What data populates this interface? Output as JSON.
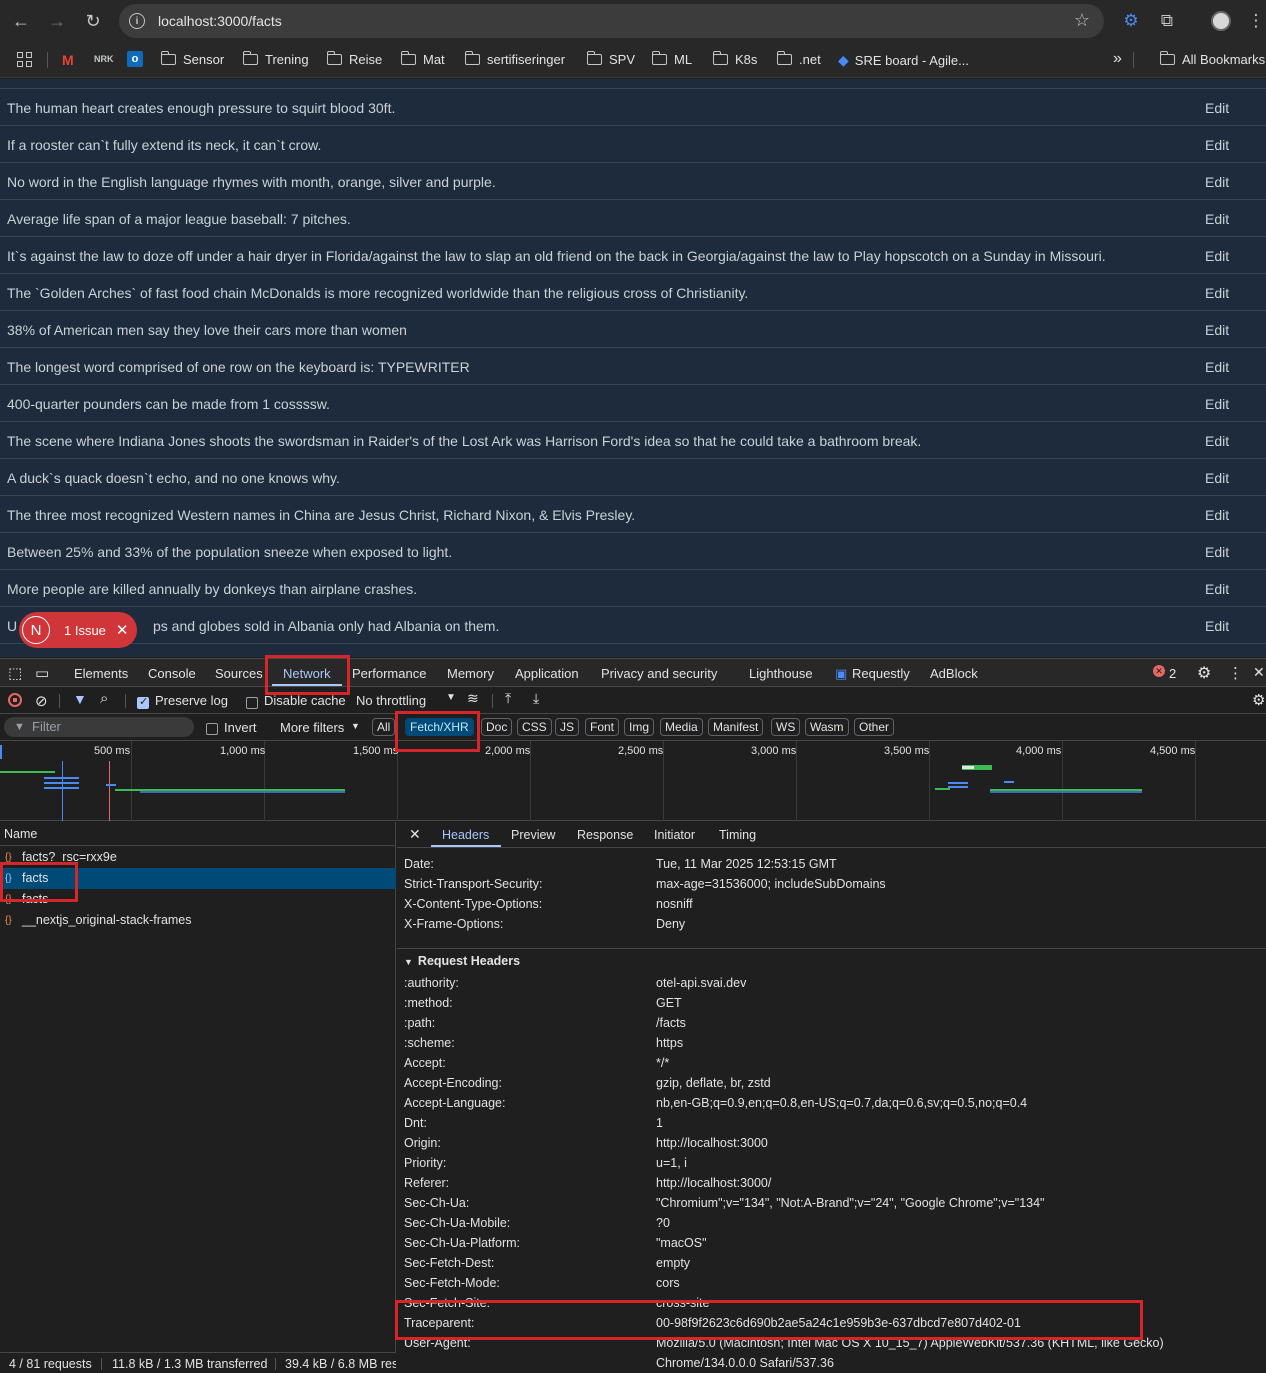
{
  "browser": {
    "url": "localhost:3000/facts",
    "bookmarks": [
      "Sensor",
      "Trening",
      "Reise",
      "Mat",
      "sertifiseringer",
      "SPV",
      "ML",
      "K8s",
      ".net",
      "SRE board - Agile..."
    ],
    "overflow": "»",
    "all_bookmarks": "All Bookmarks"
  },
  "facts": {
    "edit_label": "Edit",
    "rows": [
      "The human heart creates enough pressure to squirt blood 30ft.",
      "If a rooster can`t fully extend its neck, it can`t crow.",
      "No word in the English language rhymes with month, orange, silver and purple.",
      "Average life span of a major league baseball: 7 pitches.",
      "It`s against the law to doze off under a hair dryer in Florida/against the law to slap an old friend on the back in Georgia/against the law to Play hopscotch on a Sunday in Missouri.",
      "The `Golden Arches` of fast food chain McDonalds is more recognized worldwide than the religious cross of Christianity.",
      "38% of American men say they love their cars more than women",
      "The longest word comprised of one row on the keyboard is: TYPEWRITER",
      "400-quarter pounders can be made from 1 cossssw.",
      "The scene where Indiana Jones shoots the swordsman in Raider's of the Lost Ark was Harrison Ford's idea so that he could take a bathroom break.",
      "A duck`s quack doesn`t echo, and no one knows why.",
      "The three most recognized Western names in China are Jesus Christ, Richard Nixon, & Elvis Presley.",
      "Between 25% and 33% of the population sneeze when exposed to light.",
      "More people are killed annually by donkeys than airplane crashes.",
      "ps and globes sold in Albania only had Albania on them."
    ],
    "partial_first_char": "U",
    "issue_badge": {
      "initial": "N",
      "label": "1 Issue"
    }
  },
  "devtools": {
    "tabs": [
      "Elements",
      "Console",
      "Sources",
      "Network",
      "Performance",
      "Memory",
      "Application",
      "Privacy and security",
      "Lighthouse",
      "Requestly",
      "AdBlock"
    ],
    "active_tab": "Network",
    "error_count": "2",
    "preserve_log": "Preserve log",
    "disable_cache": "Disable cache",
    "throttling": "No throttling",
    "filter_placeholder": "Filter",
    "invert": "Invert",
    "more_filters": "More filters",
    "type_filters": [
      "All",
      "Fetch/XHR",
      "Doc",
      "CSS",
      "JS",
      "Font",
      "Img",
      "Media",
      "Manifest",
      "WS",
      "Wasm",
      "Other"
    ],
    "active_type_filter": "Fetch/XHR",
    "timeline_ticks": [
      "500 ms",
      "1,000 ms",
      "1,500 ms",
      "2,000 ms",
      "2,500 ms",
      "3,000 ms",
      "3,500 ms",
      "4,000 ms",
      "4,500 ms"
    ],
    "name_header": "Name",
    "requests": [
      "facts?_rsc=rxx9e",
      "facts",
      "facts",
      "__nextjs_original-stack-frames"
    ],
    "selected_request": "facts",
    "detail_tabs": [
      "Headers",
      "Preview",
      "Response",
      "Initiator",
      "Timing"
    ],
    "active_detail_tab": "Headers",
    "response_headers": [
      {
        "key": "Date:",
        "value": "Tue, 11 Mar 2025 12:53:15 GMT"
      },
      {
        "key": "Strict-Transport-Security:",
        "value": "max-age=31536000; includeSubDomains"
      },
      {
        "key": "X-Content-Type-Options:",
        "value": "nosniff"
      },
      {
        "key": "X-Frame-Options:",
        "value": "Deny"
      }
    ],
    "request_headers_title": "Request Headers",
    "request_headers": [
      {
        "key": ":authority:",
        "value": "otel-api.svai.dev"
      },
      {
        "key": ":method:",
        "value": "GET"
      },
      {
        "key": ":path:",
        "value": "/facts"
      },
      {
        "key": ":scheme:",
        "value": "https"
      },
      {
        "key": "Accept:",
        "value": "*/*"
      },
      {
        "key": "Accept-Encoding:",
        "value": "gzip, deflate, br, zstd"
      },
      {
        "key": "Accept-Language:",
        "value": "nb,en-GB;q=0.9,en;q=0.8,en-US;q=0.7,da;q=0.6,sv;q=0.5,no;q=0.4"
      },
      {
        "key": "Dnt:",
        "value": "1"
      },
      {
        "key": "Origin:",
        "value": "http://localhost:3000"
      },
      {
        "key": "Priority:",
        "value": "u=1, i"
      },
      {
        "key": "Referer:",
        "value": "http://localhost:3000/"
      },
      {
        "key": "Sec-Ch-Ua:",
        "value": "\"Chromium\";v=\"134\", \"Not:A-Brand\";v=\"24\", \"Google Chrome\";v=\"134\""
      },
      {
        "key": "Sec-Ch-Ua-Mobile:",
        "value": "?0"
      },
      {
        "key": "Sec-Ch-Ua-Platform:",
        "value": "\"macOS\""
      },
      {
        "key": "Sec-Fetch-Dest:",
        "value": "empty"
      },
      {
        "key": "Sec-Fetch-Mode:",
        "value": "cors"
      },
      {
        "key": "Sec-Fetch-Site:",
        "value": "cross-site"
      },
      {
        "key": "Traceparent:",
        "value": "00-98f9f2623c6d690b2ae5a24c1e959b3e-637dbcd7e807d402-01"
      },
      {
        "key": "User-Agent:",
        "value": "Mozilla/5.0 (Macintosh; Intel Mac OS X 10_15_7) AppleWebKit/537.36 (KHTML, like Gecko)"
      }
    ],
    "user_agent_cont": "Chrome/134.0.0.0 Safari/537.36",
    "status": {
      "requests": "4 / 81 requests",
      "transferred": "11.8 kB / 1.3 MB transferred",
      "resources": "39.4 kB / 6.8 MB res"
    }
  }
}
